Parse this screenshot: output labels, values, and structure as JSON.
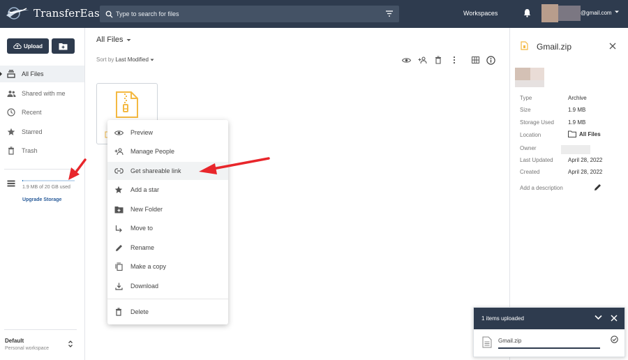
{
  "app": {
    "brand": "TransferEasy",
    "search_placeholder": "Type to search for files",
    "workspaces_label": "Workspaces",
    "user_email": "@gmail.com"
  },
  "sidebar": {
    "upload_label": "Upload",
    "items": [
      {
        "label": "All Files",
        "icon": "files-stack-icon",
        "active": true
      },
      {
        "label": "Shared with me",
        "icon": "people-icon",
        "active": false
      },
      {
        "label": "Recent",
        "icon": "clock-icon",
        "active": false
      },
      {
        "label": "Starred",
        "icon": "star-icon",
        "active": false
      },
      {
        "label": "Trash",
        "icon": "trash-icon",
        "active": false
      }
    ],
    "storage": {
      "text": "1.9 MB of 20 GB used",
      "used_fraction": 0.0001
    },
    "upgrade_label": "Upgrade Storage",
    "workspace": {
      "name": "Default",
      "subtitle": "Personal workspace"
    }
  },
  "main": {
    "title": "All Files",
    "sort_prefix": "Sort by",
    "sort_value": "Last Modified"
  },
  "context_menu": {
    "items": [
      {
        "label": "Preview",
        "icon": "eye-icon"
      },
      {
        "label": "Manage People",
        "icon": "person-add-icon"
      },
      {
        "label": "Get shareable link",
        "icon": "link-icon"
      },
      {
        "label": "Add a star",
        "icon": "star-icon"
      },
      {
        "label": "New Folder",
        "icon": "new-folder-icon"
      },
      {
        "label": "Move to",
        "icon": "move-arrow-icon"
      },
      {
        "label": "Rename",
        "icon": "pencil-icon"
      },
      {
        "label": "Make a copy",
        "icon": "copy-icon"
      },
      {
        "label": "Download",
        "icon": "download-icon"
      },
      {
        "label": "Delete",
        "icon": "trash-icon"
      }
    ]
  },
  "details": {
    "file_name": "Gmail.zip",
    "type_label": "Type",
    "type_value": "Archive",
    "size_label": "Size",
    "size_value": "1.9 MB",
    "storage_label": "Storage Used",
    "storage_value": "1.9 MB",
    "location_label": "Location",
    "location_value": "All Files",
    "owner_label": "Owner",
    "updated_label": "Last Updated",
    "updated_value": "April 28, 2022",
    "created_label": "Created",
    "created_value": "April 28, 2022",
    "description_placeholder": "Add a description"
  },
  "upload_toast": {
    "title": "1 items uploaded",
    "file_name": "Gmail.zip"
  },
  "colors": {
    "topbar": "#2e3b4e",
    "annotation_arrow": "#e8262b",
    "zip_accent": "#f4b942",
    "link": "#2a5c9a"
  }
}
